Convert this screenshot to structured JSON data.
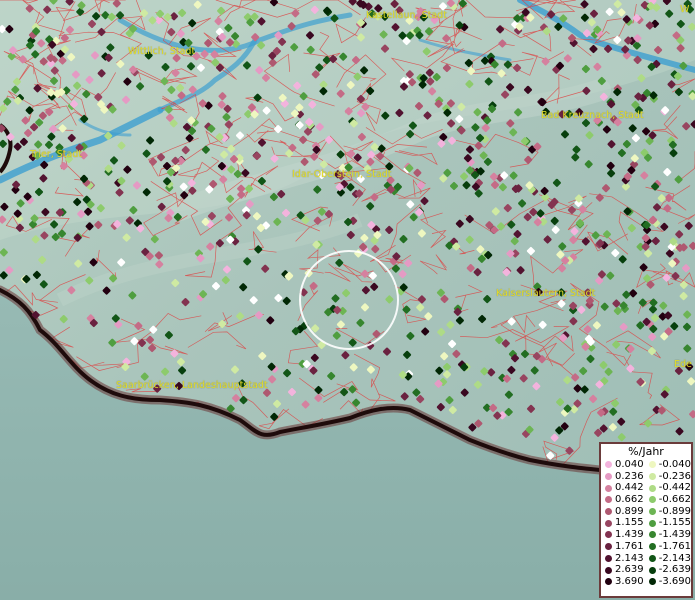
{
  "map": {
    "cities": [
      {
        "name": "Kastellaun, Stadt"
      },
      {
        "name": "Wittlich, Stadt"
      },
      {
        "name": "Trier, Stadt"
      },
      {
        "name": "Idar-Oberstein, Stadt"
      },
      {
        "name": "Bad Kreuznach, Stadt"
      },
      {
        "name": "Kaiserslautern, Stadt"
      },
      {
        "name": "Saarbrücken, Landeshauptstadt"
      },
      {
        "name": "Ede"
      },
      {
        "name": "W"
      }
    ],
    "colors": {
      "water": "#3d9fd0",
      "border": "#d44",
      "state_border": "#2a1414",
      "label": "#e4de2a"
    }
  },
  "legend": {
    "title": "%/Jahr",
    "positive": [
      {
        "label": "0.040",
        "color": "#f3b3dd"
      },
      {
        "label": "0.236",
        "color": "#e59ac4"
      },
      {
        "label": "0.442",
        "color": "#d5819f"
      },
      {
        "label": "0.662",
        "color": "#c46b86"
      },
      {
        "label": "0.899",
        "color": "#af5870"
      },
      {
        "label": "1.155",
        "color": "#984560"
      },
      {
        "label": "1.439",
        "color": "#833350"
      },
      {
        "label": "1.761",
        "color": "#6a2240"
      },
      {
        "label": "2.143",
        "color": "#521330"
      },
      {
        "label": "2.639",
        "color": "#3a0820"
      },
      {
        "label": "3.690",
        "color": "#220010"
      }
    ],
    "negative": [
      {
        "label": "-0.040",
        "color": "#eef7c0"
      },
      {
        "label": "-0.236",
        "color": "#cfeaa2"
      },
      {
        "label": "-0.442",
        "color": "#aedb86"
      },
      {
        "label": "-0.662",
        "color": "#8dcb6c"
      },
      {
        "label": "-0.899",
        "color": "#6db554"
      },
      {
        "label": "-1.155",
        "color": "#4f9e40"
      },
      {
        "label": "-1.439",
        "color": "#37862f"
      },
      {
        "label": "-1.761",
        "color": "#226e22"
      },
      {
        "label": "-2.143",
        "color": "#125617"
      },
      {
        "label": "-2.639",
        "color": "#073f0d"
      },
      {
        "label": "-3.690",
        "color": "#012805"
      }
    ]
  }
}
